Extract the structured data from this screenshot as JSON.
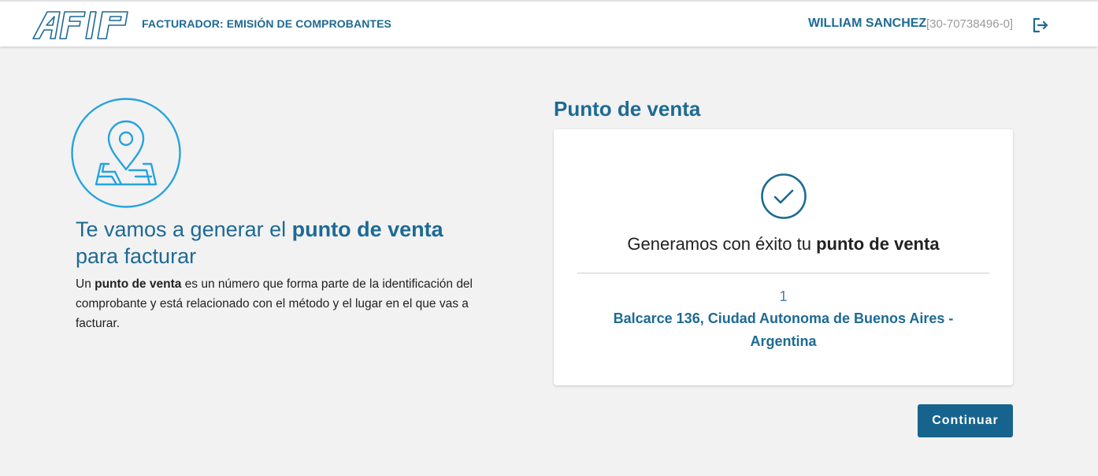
{
  "header": {
    "logo_text": "AFIP",
    "app_title": "FACTURADOR: EMISIÓN DE COMPROBANTES",
    "user_name": "WILLIAM SANCHEZ",
    "user_cuit": "[30-70738496-0]",
    "logout_icon": "logout-icon"
  },
  "intro": {
    "icon": "map-location-icon",
    "title_pre": "Te vamos a generar el ",
    "title_bold": "punto de venta",
    "title_post": "para facturar",
    "desc_pre": "Un ",
    "desc_bold": "punto de venta",
    "desc_post": " es un número que forma parte de la identificación del comprobante y está relacionado con el método y el lugar en el que vas a facturar."
  },
  "result": {
    "section_title": "Punto de venta",
    "icon": "check-circle-icon",
    "success_pre": "Generamos con éxito tu ",
    "success_bold": "punto de venta",
    "number": "1",
    "address": "Balcarce 136, Ciudad Autonoma de Buenos Aires - Argentina"
  },
  "actions": {
    "continue_label": "Continuar"
  },
  "colors": {
    "primary": "#1d6a94",
    "button": "#16648e",
    "accent_icon": "#27a3dd",
    "background": "#f2f2f2"
  }
}
